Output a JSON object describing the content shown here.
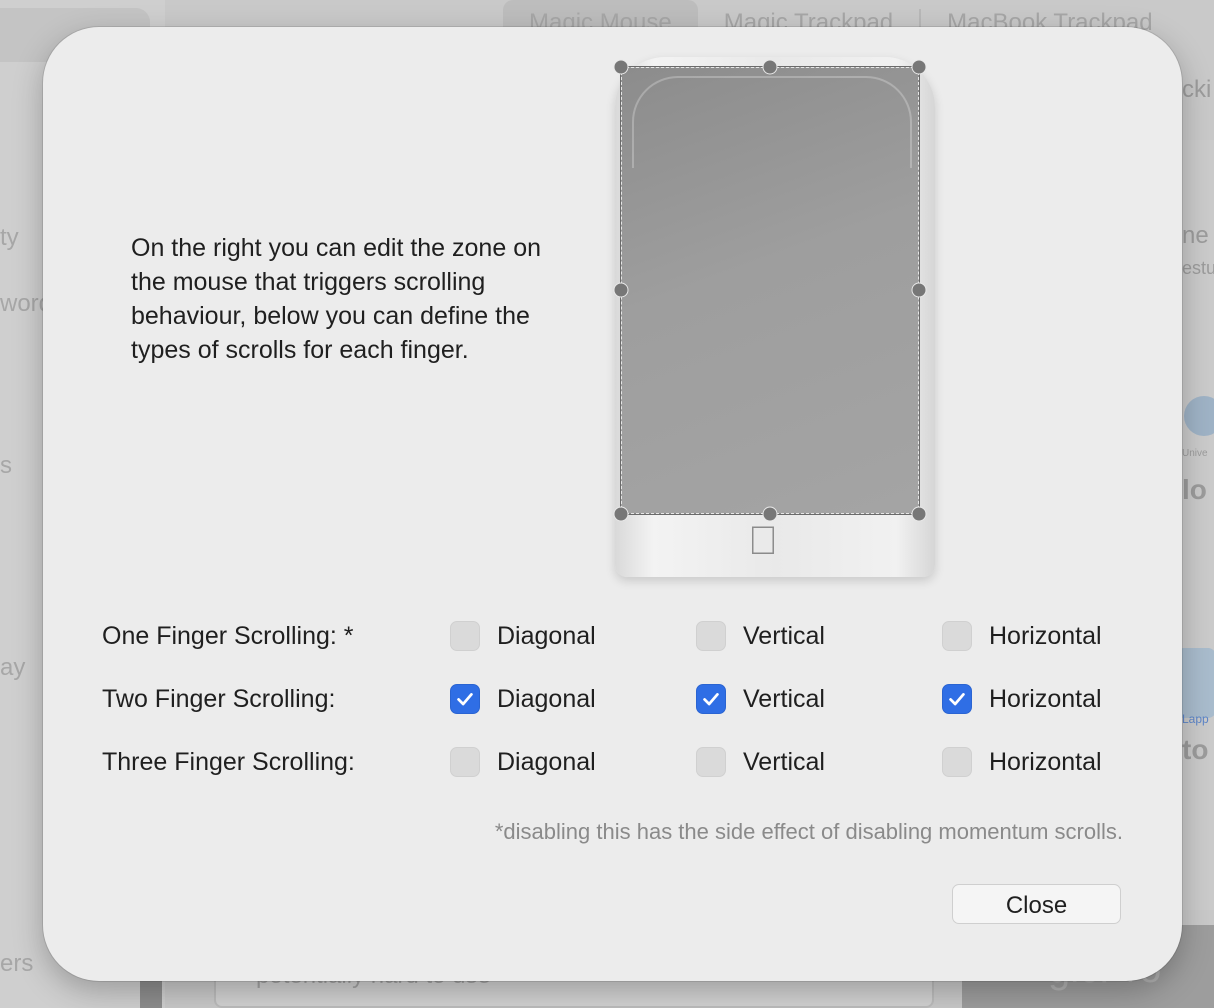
{
  "background": {
    "tabs": [
      "Magic Mouse",
      "Magic Trackpad",
      "MacBook Trackpad"
    ],
    "side_labels": [
      "ty",
      "word",
      "s",
      "ay",
      "ers"
    ],
    "right_texts": [
      "cki",
      "ne g",
      "estu",
      "Unive",
      "lo",
      "Lapp",
      "to"
    ],
    "bottom_field_text": "potentially hard to use",
    "bottom_button_text": "gicPro"
  },
  "dialog": {
    "intro_text": "On the right you can edit the zone on the mouse that triggers scrolling behaviour, below you can define the types of scrolls for each finger.",
    "rows": [
      {
        "label": "One Finger Scrolling: *",
        "options": [
          {
            "label": "Diagonal",
            "checked": false
          },
          {
            "label": "Vertical",
            "checked": false
          },
          {
            "label": "Horizontal",
            "checked": false
          }
        ]
      },
      {
        "label": "Two Finger Scrolling:",
        "options": [
          {
            "label": "Diagonal",
            "checked": true
          },
          {
            "label": "Vertical",
            "checked": true
          },
          {
            "label": "Horizontal",
            "checked": true
          }
        ]
      },
      {
        "label": "Three Finger Scrolling:",
        "options": [
          {
            "label": "Diagonal",
            "checked": false
          },
          {
            "label": "Vertical",
            "checked": false
          },
          {
            "label": "Horizontal",
            "checked": false
          }
        ]
      }
    ],
    "footnote": "*disabling this has the side effect of disabling momentum scrolls.",
    "close_label": "Close",
    "accent_color": "#2f6ee5",
    "icons": {
      "checkmark": "checkmark-icon",
      "apple_logo": "apple-logo-icon"
    }
  }
}
